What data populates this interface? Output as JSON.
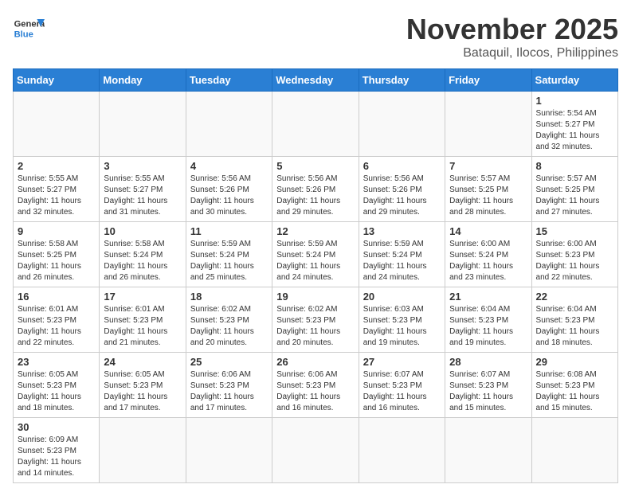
{
  "logo": {
    "general": "General",
    "blue": "Blue"
  },
  "header": {
    "month": "November 2025",
    "location": "Bataquil, Ilocos, Philippines"
  },
  "weekdays": [
    "Sunday",
    "Monday",
    "Tuesday",
    "Wednesday",
    "Thursday",
    "Friday",
    "Saturday"
  ],
  "weeks": [
    [
      {
        "day": "",
        "sunrise": "",
        "sunset": "",
        "daylight": ""
      },
      {
        "day": "",
        "sunrise": "",
        "sunset": "",
        "daylight": ""
      },
      {
        "day": "",
        "sunrise": "",
        "sunset": "",
        "daylight": ""
      },
      {
        "day": "",
        "sunrise": "",
        "sunset": "",
        "daylight": ""
      },
      {
        "day": "",
        "sunrise": "",
        "sunset": "",
        "daylight": ""
      },
      {
        "day": "",
        "sunrise": "",
        "sunset": "",
        "daylight": ""
      },
      {
        "day": "1",
        "sunrise": "Sunrise: 5:54 AM",
        "sunset": "Sunset: 5:27 PM",
        "daylight": "Daylight: 11 hours and 32 minutes."
      }
    ],
    [
      {
        "day": "2",
        "sunrise": "Sunrise: 5:55 AM",
        "sunset": "Sunset: 5:27 PM",
        "daylight": "Daylight: 11 hours and 32 minutes."
      },
      {
        "day": "3",
        "sunrise": "Sunrise: 5:55 AM",
        "sunset": "Sunset: 5:27 PM",
        "daylight": "Daylight: 11 hours and 31 minutes."
      },
      {
        "day": "4",
        "sunrise": "Sunrise: 5:56 AM",
        "sunset": "Sunset: 5:26 PM",
        "daylight": "Daylight: 11 hours and 30 minutes."
      },
      {
        "day": "5",
        "sunrise": "Sunrise: 5:56 AM",
        "sunset": "Sunset: 5:26 PM",
        "daylight": "Daylight: 11 hours and 29 minutes."
      },
      {
        "day": "6",
        "sunrise": "Sunrise: 5:56 AM",
        "sunset": "Sunset: 5:26 PM",
        "daylight": "Daylight: 11 hours and 29 minutes."
      },
      {
        "day": "7",
        "sunrise": "Sunrise: 5:57 AM",
        "sunset": "Sunset: 5:25 PM",
        "daylight": "Daylight: 11 hours and 28 minutes."
      },
      {
        "day": "8",
        "sunrise": "Sunrise: 5:57 AM",
        "sunset": "Sunset: 5:25 PM",
        "daylight": "Daylight: 11 hours and 27 minutes."
      }
    ],
    [
      {
        "day": "9",
        "sunrise": "Sunrise: 5:58 AM",
        "sunset": "Sunset: 5:25 PM",
        "daylight": "Daylight: 11 hours and 26 minutes."
      },
      {
        "day": "10",
        "sunrise": "Sunrise: 5:58 AM",
        "sunset": "Sunset: 5:24 PM",
        "daylight": "Daylight: 11 hours and 26 minutes."
      },
      {
        "day": "11",
        "sunrise": "Sunrise: 5:59 AM",
        "sunset": "Sunset: 5:24 PM",
        "daylight": "Daylight: 11 hours and 25 minutes."
      },
      {
        "day": "12",
        "sunrise": "Sunrise: 5:59 AM",
        "sunset": "Sunset: 5:24 PM",
        "daylight": "Daylight: 11 hours and 24 minutes."
      },
      {
        "day": "13",
        "sunrise": "Sunrise: 5:59 AM",
        "sunset": "Sunset: 5:24 PM",
        "daylight": "Daylight: 11 hours and 24 minutes."
      },
      {
        "day": "14",
        "sunrise": "Sunrise: 6:00 AM",
        "sunset": "Sunset: 5:24 PM",
        "daylight": "Daylight: 11 hours and 23 minutes."
      },
      {
        "day": "15",
        "sunrise": "Sunrise: 6:00 AM",
        "sunset": "Sunset: 5:23 PM",
        "daylight": "Daylight: 11 hours and 22 minutes."
      }
    ],
    [
      {
        "day": "16",
        "sunrise": "Sunrise: 6:01 AM",
        "sunset": "Sunset: 5:23 PM",
        "daylight": "Daylight: 11 hours and 22 minutes."
      },
      {
        "day": "17",
        "sunrise": "Sunrise: 6:01 AM",
        "sunset": "Sunset: 5:23 PM",
        "daylight": "Daylight: 11 hours and 21 minutes."
      },
      {
        "day": "18",
        "sunrise": "Sunrise: 6:02 AM",
        "sunset": "Sunset: 5:23 PM",
        "daylight": "Daylight: 11 hours and 20 minutes."
      },
      {
        "day": "19",
        "sunrise": "Sunrise: 6:02 AM",
        "sunset": "Sunset: 5:23 PM",
        "daylight": "Daylight: 11 hours and 20 minutes."
      },
      {
        "day": "20",
        "sunrise": "Sunrise: 6:03 AM",
        "sunset": "Sunset: 5:23 PM",
        "daylight": "Daylight: 11 hours and 19 minutes."
      },
      {
        "day": "21",
        "sunrise": "Sunrise: 6:04 AM",
        "sunset": "Sunset: 5:23 PM",
        "daylight": "Daylight: 11 hours and 19 minutes."
      },
      {
        "day": "22",
        "sunrise": "Sunrise: 6:04 AM",
        "sunset": "Sunset: 5:23 PM",
        "daylight": "Daylight: 11 hours and 18 minutes."
      }
    ],
    [
      {
        "day": "23",
        "sunrise": "Sunrise: 6:05 AM",
        "sunset": "Sunset: 5:23 PM",
        "daylight": "Daylight: 11 hours and 18 minutes."
      },
      {
        "day": "24",
        "sunrise": "Sunrise: 6:05 AM",
        "sunset": "Sunset: 5:23 PM",
        "daylight": "Daylight: 11 hours and 17 minutes."
      },
      {
        "day": "25",
        "sunrise": "Sunrise: 6:06 AM",
        "sunset": "Sunset: 5:23 PM",
        "daylight": "Daylight: 11 hours and 17 minutes."
      },
      {
        "day": "26",
        "sunrise": "Sunrise: 6:06 AM",
        "sunset": "Sunset: 5:23 PM",
        "daylight": "Daylight: 11 hours and 16 minutes."
      },
      {
        "day": "27",
        "sunrise": "Sunrise: 6:07 AM",
        "sunset": "Sunset: 5:23 PM",
        "daylight": "Daylight: 11 hours and 16 minutes."
      },
      {
        "day": "28",
        "sunrise": "Sunrise: 6:07 AM",
        "sunset": "Sunset: 5:23 PM",
        "daylight": "Daylight: 11 hours and 15 minutes."
      },
      {
        "day": "29",
        "sunrise": "Sunrise: 6:08 AM",
        "sunset": "Sunset: 5:23 PM",
        "daylight": "Daylight: 11 hours and 15 minutes."
      }
    ],
    [
      {
        "day": "30",
        "sunrise": "Sunrise: 6:09 AM",
        "sunset": "Sunset: 5:23 PM",
        "daylight": "Daylight: 11 hours and 14 minutes."
      },
      {
        "day": "",
        "sunrise": "",
        "sunset": "",
        "daylight": ""
      },
      {
        "day": "",
        "sunrise": "",
        "sunset": "",
        "daylight": ""
      },
      {
        "day": "",
        "sunrise": "",
        "sunset": "",
        "daylight": ""
      },
      {
        "day": "",
        "sunrise": "",
        "sunset": "",
        "daylight": ""
      },
      {
        "day": "",
        "sunrise": "",
        "sunset": "",
        "daylight": ""
      },
      {
        "day": "",
        "sunrise": "",
        "sunset": "",
        "daylight": ""
      }
    ]
  ]
}
